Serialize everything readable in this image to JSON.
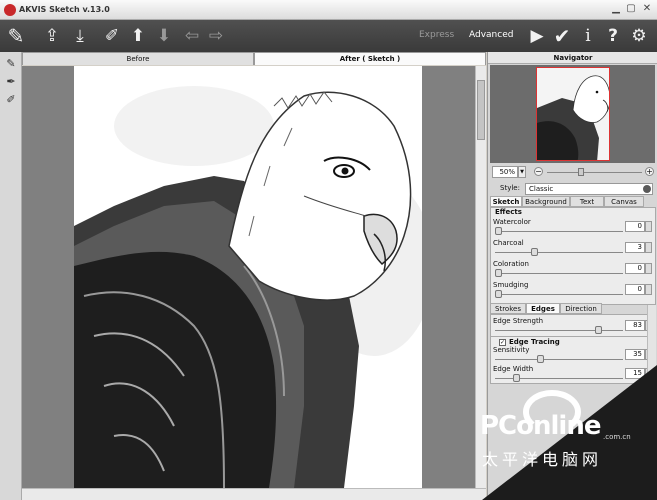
{
  "app": {
    "title": "AKVIS Sketch v.13.0"
  },
  "modes": {
    "express": "Express",
    "advanced": "Advanced"
  },
  "toolbar": {
    "icons": [
      "sketch-tool-icon",
      "open-image-icon",
      "save-image-icon",
      "eraser-tool-icon",
      "upload-icon",
      "download-icon",
      "undo-arrow-icon",
      "redo-arrow-icon",
      "run-icon",
      "apply-check-icon",
      "info-icon",
      "help-icon",
      "settings-gear-icon"
    ]
  },
  "view_tabs": {
    "before": "Before",
    "after": "After ( Sketch )"
  },
  "navigator": {
    "title": "Navigator",
    "zoom": "50%"
  },
  "style": {
    "label": "Style:",
    "value": "Classic"
  },
  "param_tabs": [
    "Sketch",
    "Background",
    "Text",
    "Canvas"
  ],
  "effects": {
    "title": "Effects",
    "params": [
      {
        "label": "Watercolor",
        "value": "0",
        "level": 0.0
      },
      {
        "label": "Charcoal",
        "value": "3",
        "level": 0.3
      },
      {
        "label": "Coloration",
        "value": "0",
        "level": 0.0
      },
      {
        "label": "Smudging",
        "value": "0",
        "level": 0.0
      }
    ]
  },
  "edge_tabs": [
    "Strokes",
    "Edges",
    "Direction"
  ],
  "edges": {
    "strength_label": "Edge Strength",
    "strength_value": "83",
    "strength_level": 0.83
  },
  "tracing": {
    "title": "Edge Tracing",
    "checked": true,
    "params": [
      {
        "label": "Sensitivity",
        "value": "35",
        "level": 0.35
      },
      {
        "label": "Edge Width",
        "value": "15",
        "level": 0.15
      }
    ]
  },
  "watermark": {
    "brand": "PConline",
    "domain": ".com.cn",
    "chinese": "太平洋电脑网"
  }
}
